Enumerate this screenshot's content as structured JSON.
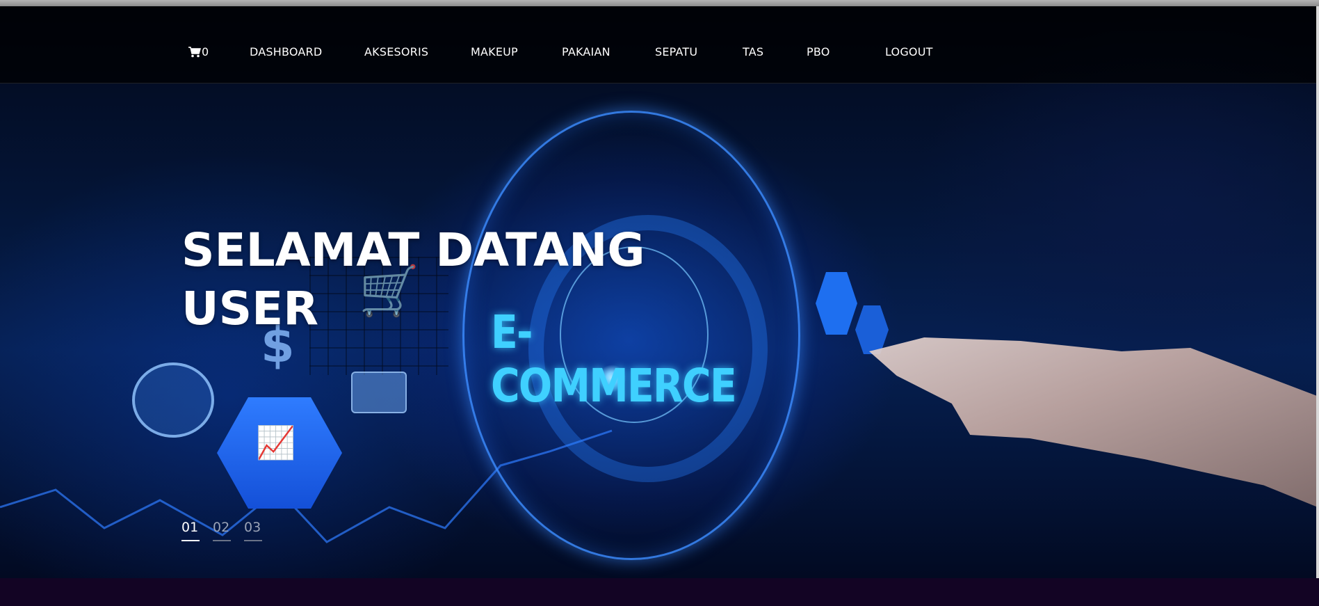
{
  "nav": {
    "cart_count": "0",
    "items": [
      {
        "label": "DASHBOARD"
      },
      {
        "label": "AKSESORIS"
      },
      {
        "label": "MAKEUP"
      },
      {
        "label": "PAKAIAN"
      },
      {
        "label": "SEPATU"
      },
      {
        "label": "TAS"
      },
      {
        "label": "PBO"
      },
      {
        "label": "LOGOUT"
      }
    ]
  },
  "hero": {
    "title_line1": "SELAMAT DATANG",
    "title_line2": "USER",
    "image_text": "E-COMMERCE",
    "pager": [
      "01",
      "02",
      "03"
    ],
    "active_slide": "01"
  },
  "colors": {
    "accent": "#3fd0ff",
    "bottom_bar": "#130424"
  }
}
